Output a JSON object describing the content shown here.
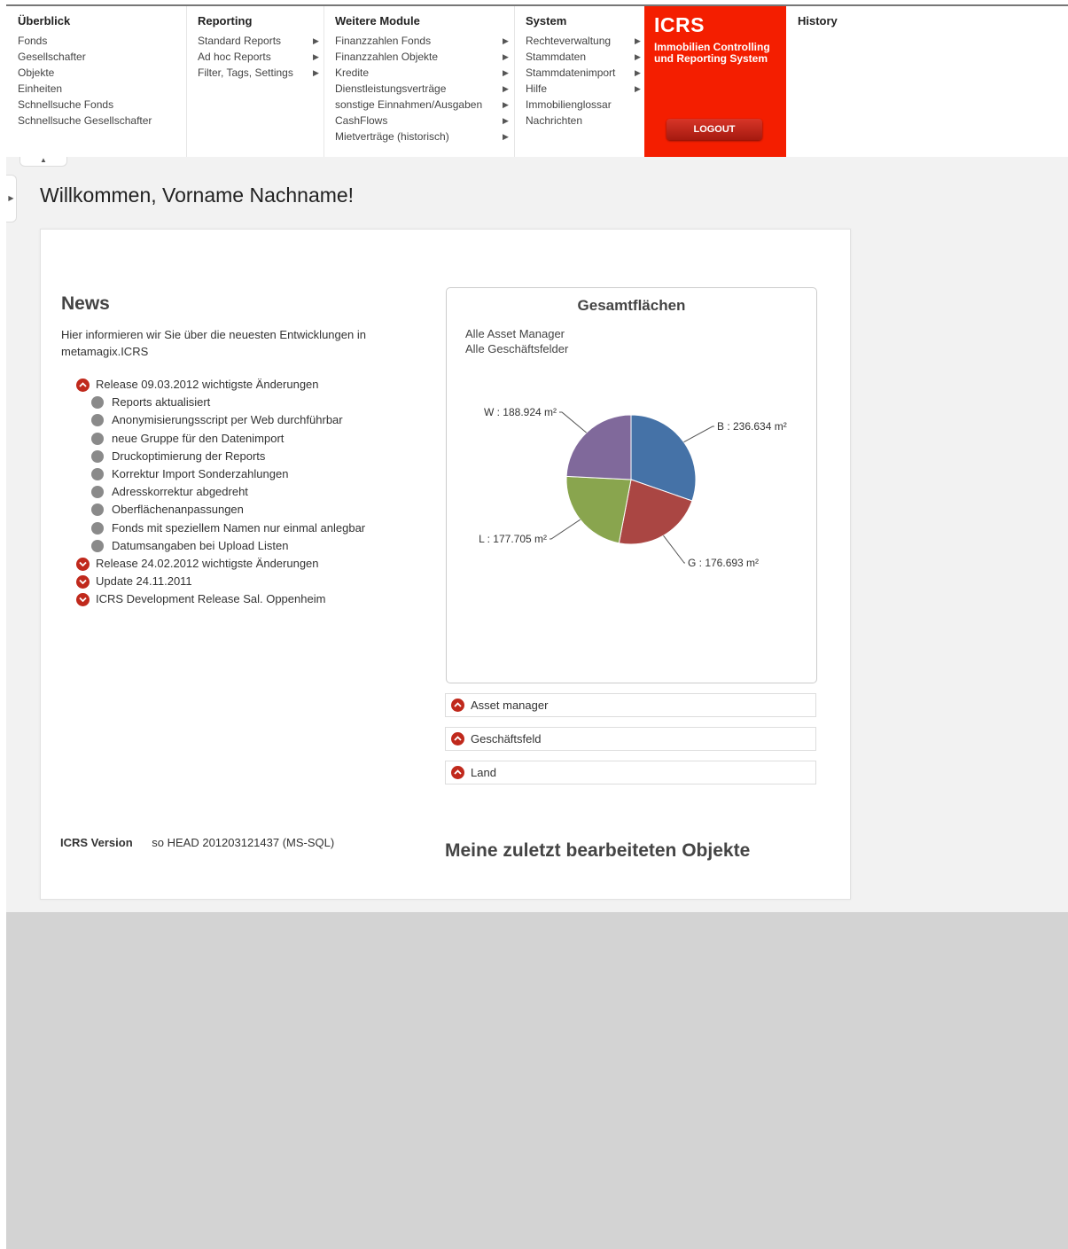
{
  "menu": {
    "overview": {
      "title": "Überblick",
      "items": [
        "Fonds",
        "Gesellschafter",
        "Objekte",
        "Einheiten",
        "Schnellsuche Fonds",
        "Schnellsuche Gesellschafter"
      ]
    },
    "reporting": {
      "title": "Reporting",
      "items": [
        "Standard Reports",
        "Ad hoc Reports",
        "Filter, Tags, Settings"
      ]
    },
    "modules": {
      "title": "Weitere Module",
      "items": [
        "Finanzzahlen Fonds",
        "Finanzzahlen Objekte",
        "Kredite",
        "Dienstleistungsverträge",
        "sonstige Einnahmen/Ausgaben",
        "CashFlows",
        "Mietverträge (historisch)"
      ]
    },
    "system": {
      "title": "System",
      "items": [
        "Rechteverwaltung",
        "Stammdaten",
        "Stammdatenimport",
        "Hilfe",
        "Immobilienglossar",
        "Nachrichten"
      ]
    },
    "icrs": {
      "title": "ICRS",
      "subtitle_1": "Immobilien Controlling",
      "subtitle_2": "und Reporting System",
      "logout_label": "LOGOUT",
      "color": "#f41e00"
    },
    "history": "History"
  },
  "welcome": "Willkommen, Vorname Nachname!",
  "news": {
    "heading": "News",
    "intro": "Hier informieren wir Sie über die neuesten Entwicklungen in metamagix.ICRS",
    "items": [
      {
        "label": "Release 09.03.2012 wichtigste Änderungen",
        "expanded": true,
        "children": [
          "Reports aktualisiert",
          "Anonymisierungsscript per Web durchführbar",
          "neue Gruppe für den Datenimport",
          "Druckoptimierung der Reports",
          "Korrektur Import Sonderzahlungen",
          "Adresskorrektur abgedreht",
          "Oberflächenanpassungen",
          "Fonds mit speziellem Namen nur einmal anlegbar",
          "Datumsangaben bei Upload Listen"
        ]
      },
      {
        "label": "Release 24.02.2012 wichtigste Änderungen",
        "expanded": false
      },
      {
        "label": "Update 24.11.2011",
        "expanded": false
      },
      {
        "label": "ICRS Development Release Sal. Oppenheim",
        "expanded": false
      }
    ]
  },
  "version": {
    "label": "ICRS Version",
    "value": "so HEAD 201203121437 (MS-SQL)"
  },
  "chart": {
    "title": "Gesamtflächen",
    "subtitle_1": "Alle Asset Manager",
    "subtitle_2": "Alle Geschäftsfelder"
  },
  "chart_data": {
    "type": "pie",
    "title": "Gesamtflächen",
    "unit": "m²",
    "slices": [
      {
        "key": "B",
        "label": "B : 236.634 m²",
        "value": 236634,
        "color": "#4572a7"
      },
      {
        "key": "G",
        "label": "G : 176.693 m²",
        "value": 176693,
        "color": "#aa4643"
      },
      {
        "key": "L",
        "label": "L : 177.705 m²",
        "value": 177705,
        "color": "#89a54e"
      },
      {
        "key": "W",
        "label": "W : 188.924 m²",
        "value": 188924,
        "color": "#80699b"
      }
    ]
  },
  "filters": [
    "Asset manager",
    "Geschäftsfeld",
    "Land"
  ],
  "recent_heading": "Meine zuletzt bearbeiteten Objekte"
}
